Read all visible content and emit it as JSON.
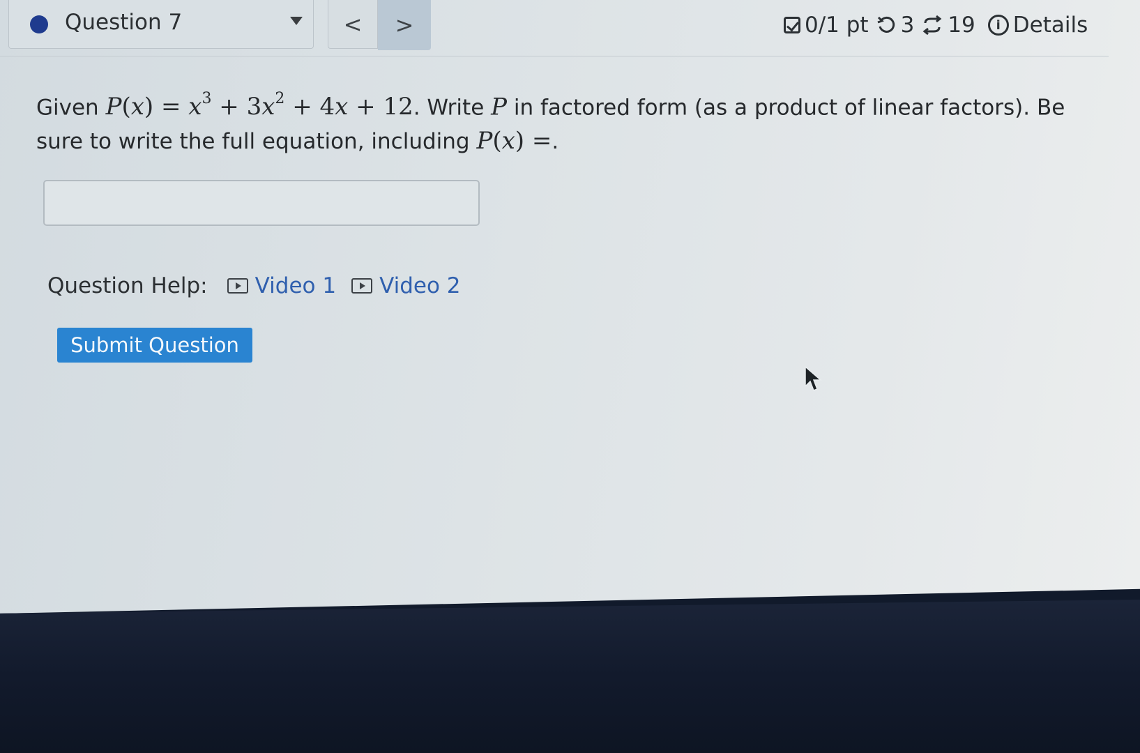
{
  "header": {
    "question_label": "Question 7",
    "prev_glyph": "<",
    "next_glyph": ">",
    "points": "0/1 pt",
    "retries": "3",
    "attempts": "19",
    "details_label": "Details",
    "icons": [
      "check-square-icon",
      "retry-icon",
      "attempts-icon",
      "info-icon",
      "chevron-down-icon"
    ]
  },
  "question": {
    "given_word": "Given",
    "text_after_equation": ". Write",
    "text_middle": "in factored form (as a product of linear factors). Be sure to write the full equation, including",
    "final": "."
  },
  "answer": {
    "value": "",
    "placeholder": ""
  },
  "help": {
    "label": "Question Help:",
    "video1": "Video 1",
    "video2": "Video 2"
  },
  "submit_label": "Submit Question",
  "colors": {
    "accent": "#2a84d1",
    "link": "#2f5fae",
    "status_dot": "#1f3b8e",
    "bezel": "#121a2c"
  }
}
